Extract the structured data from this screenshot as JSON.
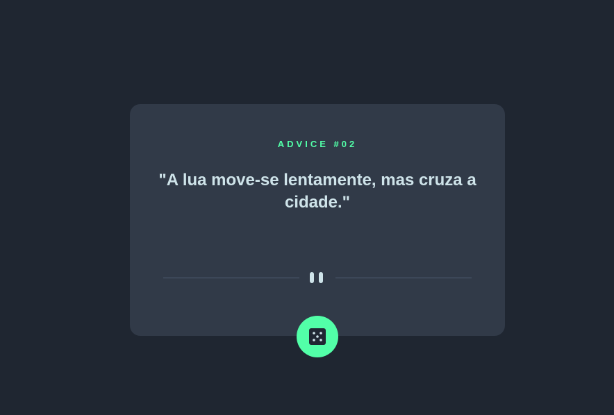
{
  "card": {
    "advice_label": "ADVICE #02",
    "quote": "\"A lua move-se lentamente, mas cruza a cidade.\""
  },
  "icons": {
    "divider": "pause-icon",
    "button": "dice-icon"
  },
  "colors": {
    "background": "#1f2631",
    "card": "#313a48",
    "accent": "#52ffa8",
    "text": "#cee3e9",
    "divider": "#4f5d74"
  }
}
